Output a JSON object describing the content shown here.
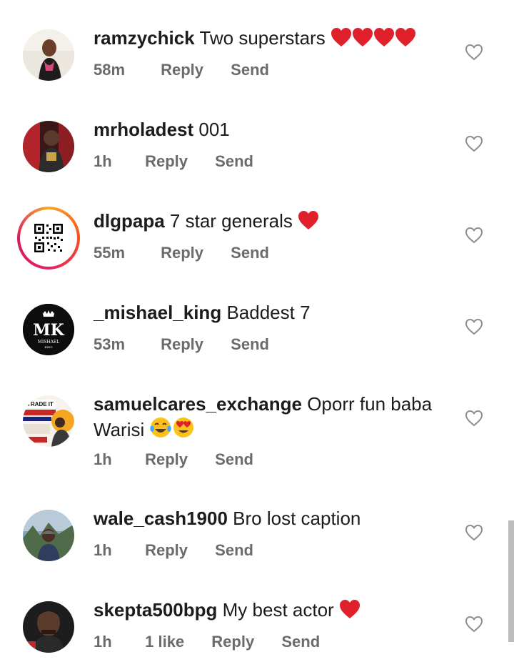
{
  "comments": [
    {
      "username": "ramzychick",
      "text": "Two superstars",
      "emoji": [
        "red-heart",
        "red-heart",
        "red-heart",
        "red-heart"
      ],
      "time": "58m",
      "likes": null,
      "reply": "Reply",
      "send": "Send"
    },
    {
      "username": "mrholadest",
      "text": "001",
      "emoji": [],
      "time": "1h",
      "likes": null,
      "reply": "Reply",
      "send": "Send"
    },
    {
      "username": "dlgpapa",
      "text": "7 star generals",
      "emoji": [
        "red-heart"
      ],
      "time": "55m",
      "likes": null,
      "reply": "Reply",
      "send": "Send"
    },
    {
      "username": "_mishael_king",
      "text": "Baddest 7",
      "emoji": [],
      "time": "53m",
      "likes": null,
      "reply": "Reply",
      "send": "Send",
      "avatar_text": [
        "MK",
        "MISHAEL",
        "KING"
      ]
    },
    {
      "username": "samuelcares_exchange",
      "text": "Oporr fun baba",
      "text2": "Warisi",
      "emoji": [
        "tears-of-joy",
        "heart-eyes"
      ],
      "time": "1h",
      "likes": null,
      "reply": "Reply",
      "send": "Send",
      "avatar_text": [
        "TRADE IT"
      ]
    },
    {
      "username": "wale_cash1900",
      "text": "Bro lost caption",
      "emoji": [],
      "time": "1h",
      "likes": null,
      "reply": "Reply",
      "send": "Send"
    },
    {
      "username": "skepta500bpg",
      "text": "My best actor",
      "emoji": [
        "red-heart"
      ],
      "time": "1h",
      "likes": "1 like",
      "reply": "Reply",
      "send": "Send"
    }
  ],
  "colors": {
    "text": "#1c1c1c",
    "meta": "#6b6b6b",
    "heart": "#e0202b",
    "scrollbar": "#bdbdbd"
  }
}
